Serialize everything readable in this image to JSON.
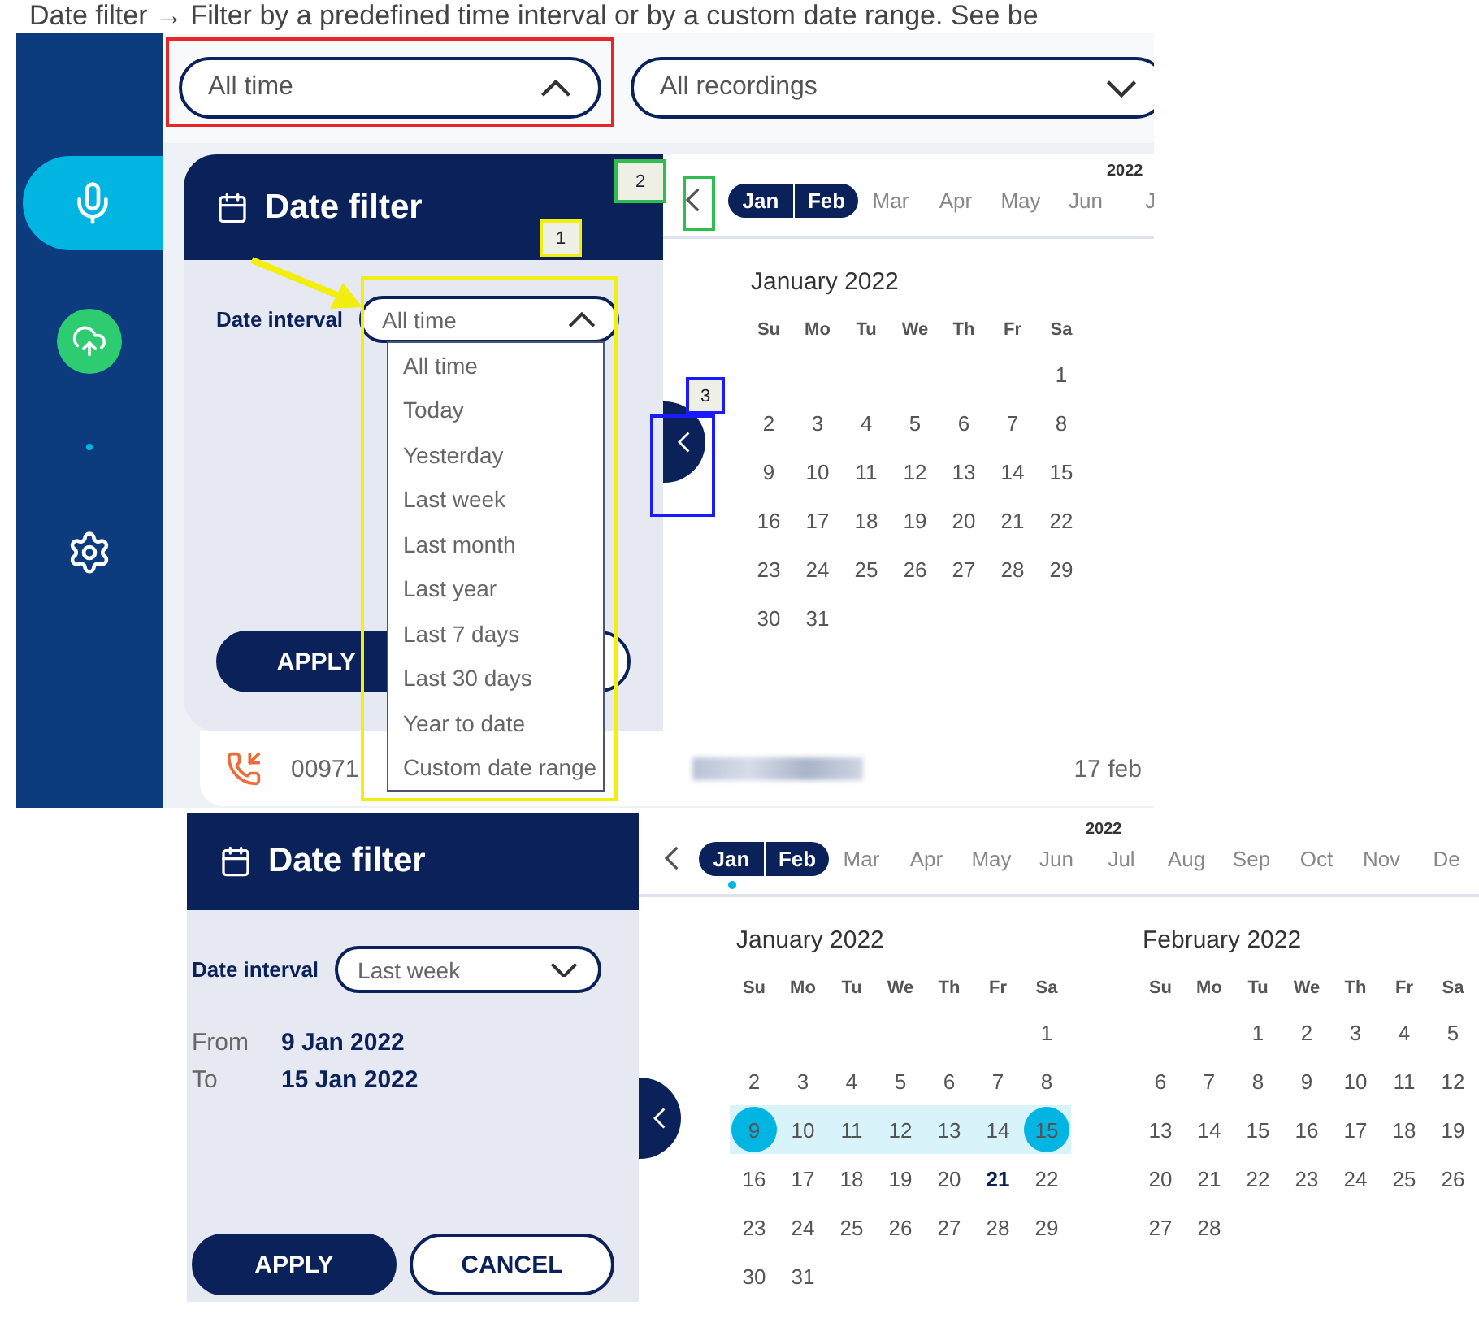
{
  "intro": "Date filter → Filter by a predefined time interval or by a custom date range. See be",
  "shot1": {
    "sidebar": [
      {
        "kind": "mic",
        "selected": true
      },
      {
        "kind": "upload",
        "selected": false
      },
      {
        "kind": "dot",
        "selected": false
      },
      {
        "kind": "settings",
        "selected": false
      }
    ],
    "filters": [
      {
        "value": "All time",
        "expanded": true
      },
      {
        "value": "All recordings",
        "expanded": false
      }
    ],
    "panel": {
      "title": "Date filter",
      "interval_label": "Date interval",
      "interval_value": "All time",
      "expanded": true,
      "apply": "APPLY",
      "options": [
        "All time",
        "Today",
        "Yesterday",
        "Last week",
        "Last month",
        "Last year",
        "Last 7 days",
        "Last 30 days",
        "Year to date",
        "Custom date range"
      ]
    },
    "strip": {
      "year": "2022",
      "months": [
        {
          "label": "Jan",
          "selected": true
        },
        {
          "label": "Feb",
          "selected": true
        },
        {
          "label": "Mar",
          "selected": false
        },
        {
          "label": "Apr",
          "selected": false
        },
        {
          "label": "May",
          "selected": false
        },
        {
          "label": "Jun",
          "selected": false
        },
        {
          "label": "J",
          "selected": false
        }
      ]
    },
    "calendar": {
      "title": "January 2022",
      "weekdays": [
        "Su",
        "Mo",
        "Tu",
        "We",
        "Th",
        "Fr",
        "Sa"
      ],
      "weeks": [
        [
          "1"
        ],
        [
          "2",
          "3",
          "4",
          "5",
          "6",
          "7",
          "8"
        ],
        [
          "9",
          "10",
          "11",
          "12",
          "13",
          "14",
          "15"
        ],
        [
          "16",
          "17",
          "18",
          "19",
          "20",
          "21",
          "22"
        ],
        [
          "23",
          "24",
          "25",
          "26",
          "27",
          "28",
          "29"
        ],
        [
          "30",
          "31"
        ]
      ]
    },
    "row": {
      "number": "00971",
      "date": "17 feb"
    },
    "annotations": [
      {
        "kind": "frame",
        "color": "#e8262a"
      },
      {
        "kind": "frame",
        "color": "#f2ee12"
      },
      {
        "kind": "frame",
        "color": "#2ebd4e"
      },
      {
        "kind": "frame",
        "color": "#1a1aff"
      },
      {
        "kind": "tag",
        "label": "1",
        "color": "#f2ee12"
      },
      {
        "kind": "tag",
        "label": "2",
        "color": "#2ebd4e"
      },
      {
        "kind": "tag",
        "label": "3",
        "color": "#1a1aff"
      },
      {
        "kind": "arrow",
        "color": "#f2ee12"
      }
    ]
  },
  "shot2": {
    "panel": {
      "title": "Date filter",
      "interval_label": "Date interval",
      "interval_value": "Last week",
      "expanded": false,
      "range": [
        {
          "label": "From",
          "value": "9 Jan 2022"
        },
        {
          "label": "To",
          "value": "15 Jan 2022"
        }
      ],
      "apply": "APPLY",
      "cancel": "CANCEL"
    },
    "strip": {
      "year": "2022",
      "months": [
        {
          "label": "Jan",
          "selected": true,
          "current": true
        },
        {
          "label": "Feb",
          "selected": true,
          "current": false
        },
        {
          "label": "Mar",
          "selected": false,
          "current": false
        },
        {
          "label": "Apr",
          "selected": false,
          "current": false
        },
        {
          "label": "May",
          "selected": false,
          "current": false
        },
        {
          "label": "Jun",
          "selected": false,
          "current": false
        },
        {
          "label": "Jul",
          "selected": false,
          "current": false
        },
        {
          "label": "Aug",
          "selected": false,
          "current": false
        },
        {
          "label": "Sep",
          "selected": false,
          "current": false
        },
        {
          "label": "Oct",
          "selected": false,
          "current": false
        },
        {
          "label": "Nov",
          "selected": false,
          "current": false
        },
        {
          "label": "De",
          "selected": false,
          "current": false
        }
      ]
    },
    "calendars": [
      {
        "title": "January 2022",
        "weekdays": [
          "Su",
          "Mo",
          "Tu",
          "We",
          "Th",
          "Fr",
          "Sa"
        ],
        "weeks": [
          [
            {
              "d": "1",
              "kind": "plain"
            }
          ],
          [
            {
              "d": "2",
              "kind": "plain"
            },
            {
              "d": "3",
              "kind": "plain"
            },
            {
              "d": "4",
              "kind": "plain"
            },
            {
              "d": "5",
              "kind": "plain"
            },
            {
              "d": "6",
              "kind": "plain"
            },
            {
              "d": "7",
              "kind": "plain"
            },
            {
              "d": "8",
              "kind": "plain"
            }
          ],
          [
            {
              "d": "9",
              "kind": "edge"
            },
            {
              "d": "10",
              "kind": "span"
            },
            {
              "d": "11",
              "kind": "span"
            },
            {
              "d": "12",
              "kind": "span"
            },
            {
              "d": "13",
              "kind": "span"
            },
            {
              "d": "14",
              "kind": "span"
            },
            {
              "d": "15",
              "kind": "edge"
            }
          ],
          [
            {
              "d": "16",
              "kind": "plain"
            },
            {
              "d": "17",
              "kind": "plain"
            },
            {
              "d": "18",
              "kind": "plain"
            },
            {
              "d": "19",
              "kind": "plain"
            },
            {
              "d": "20",
              "kind": "plain"
            },
            {
              "d": "21",
              "kind": "today"
            },
            {
              "d": "22",
              "kind": "plain"
            }
          ],
          [
            {
              "d": "23",
              "kind": "plain"
            },
            {
              "d": "24",
              "kind": "plain"
            },
            {
              "d": "25",
              "kind": "plain"
            },
            {
              "d": "26",
              "kind": "plain"
            },
            {
              "d": "27",
              "kind": "plain"
            },
            {
              "d": "28",
              "kind": "plain"
            },
            {
              "d": "29",
              "kind": "plain"
            }
          ],
          [
            {
              "d": "30",
              "kind": "plain"
            },
            {
              "d": "31",
              "kind": "plain"
            }
          ]
        ]
      },
      {
        "title": "February 2022",
        "weekdays": [
          "Su",
          "Mo",
          "Tu",
          "We",
          "Th",
          "Fr",
          "Sa"
        ],
        "weeks": [
          [
            {
              "d": "1",
              "kind": "plain"
            },
            {
              "d": "2",
              "kind": "plain"
            },
            {
              "d": "3",
              "kind": "plain"
            },
            {
              "d": "4",
              "kind": "plain"
            },
            {
              "d": "5",
              "kind": "plain"
            }
          ],
          [
            {
              "d": "6",
              "kind": "plain"
            },
            {
              "d": "7",
              "kind": "plain"
            },
            {
              "d": "8",
              "kind": "plain"
            },
            {
              "d": "9",
              "kind": "plain"
            },
            {
              "d": "10",
              "kind": "plain"
            },
            {
              "d": "11",
              "kind": "plain"
            },
            {
              "d": "12",
              "kind": "plain"
            }
          ],
          [
            {
              "d": "13",
              "kind": "plain"
            },
            {
              "d": "14",
              "kind": "plain"
            },
            {
              "d": "15",
              "kind": "plain"
            },
            {
              "d": "16",
              "kind": "plain"
            },
            {
              "d": "17",
              "kind": "plain"
            },
            {
              "d": "18",
              "kind": "plain"
            },
            {
              "d": "19",
              "kind": "plain"
            }
          ],
          [
            {
              "d": "20",
              "kind": "plain"
            },
            {
              "d": "21",
              "kind": "plain"
            },
            {
              "d": "22",
              "kind": "plain"
            },
            {
              "d": "23",
              "kind": "plain"
            },
            {
              "d": "24",
              "kind": "plain"
            },
            {
              "d": "25",
              "kind": "plain"
            },
            {
              "d": "26",
              "kind": "plain"
            }
          ],
          [
            {
              "d": "27",
              "kind": "plain"
            },
            {
              "d": "28",
              "kind": "plain"
            }
          ]
        ]
      }
    ]
  }
}
